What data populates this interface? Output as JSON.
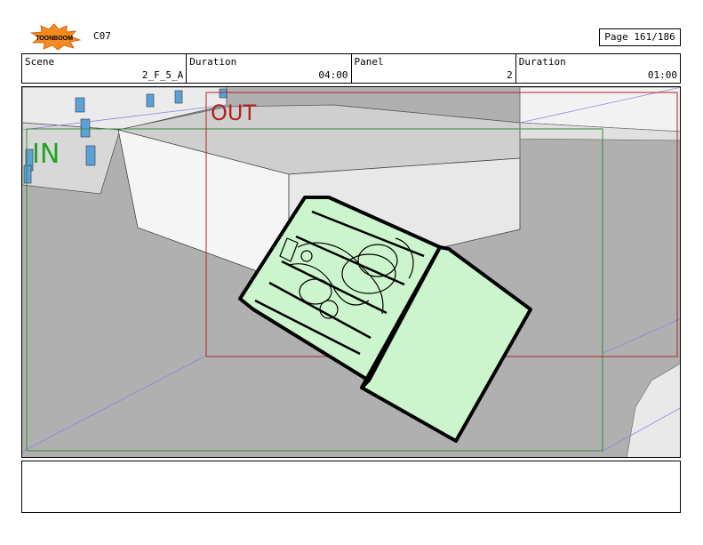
{
  "header": {
    "logo_text": "TOONBOOM",
    "sheet_code": "C07",
    "page_label": "Page 161/186"
  },
  "info": {
    "scene_label": "Scene",
    "scene_value": "2_F_5_A",
    "duration_label": "Duration",
    "duration_value": "04:00",
    "panel_label": "Panel",
    "panel_value": "2",
    "panel_duration_label": "Duration",
    "panel_duration_value": "01:00"
  },
  "panel": {
    "in_label": "IN",
    "out_label": "OUT",
    "in_color": "#22a322",
    "out_color": "#b22222",
    "object_fill": "#cdf5cd"
  },
  "notes": {
    "text": ""
  }
}
